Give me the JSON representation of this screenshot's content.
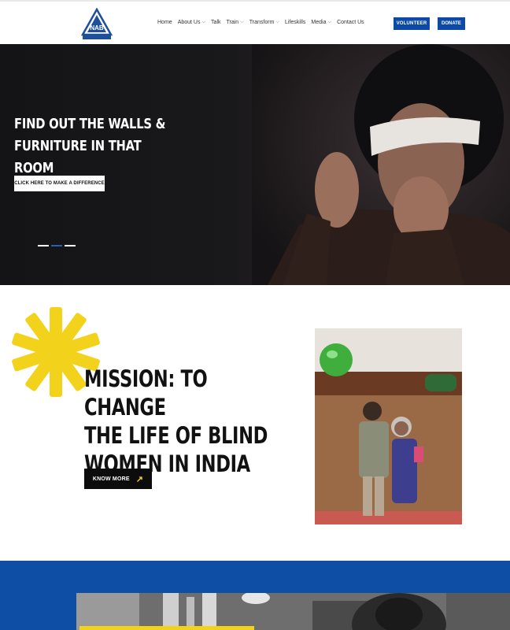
{
  "header": {
    "logo_icon": "nab-logo-icon",
    "nav": [
      {
        "label": "Home",
        "has_dropdown": false
      },
      {
        "label": "About Us",
        "has_dropdown": true
      },
      {
        "label": "Talk",
        "has_dropdown": false
      },
      {
        "label": "Train",
        "has_dropdown": true
      },
      {
        "label": "Transform",
        "has_dropdown": true
      },
      {
        "label": "Lifeskills",
        "has_dropdown": false
      },
      {
        "label": "Media",
        "has_dropdown": true
      },
      {
        "label": "Contact Us",
        "has_dropdown": false
      }
    ],
    "volunteer_label": "VOLUNTEER",
    "donate_label": "DONATE",
    "button_color": "#0d4aa6"
  },
  "hero": {
    "title_line1": "FIND OUT THE WALLS &",
    "title_line2": "FURNITURE IN THAT ROOM",
    "cta_label": "CLICK HERE TO MAKE A DIFFERENCE",
    "slide_count": 3,
    "active_slide": 2
  },
  "mission": {
    "title_line1": "MISSION: TO CHANGE",
    "title_line2": "THE LIFE OF BLIND",
    "title_line3": "WOMEN IN INDIA",
    "button_label": "KNOW MORE",
    "button_icon": "arrow-up-right-icon",
    "accent_color": "#f2d21b"
  },
  "band": {
    "color": "#0e4fa5"
  }
}
